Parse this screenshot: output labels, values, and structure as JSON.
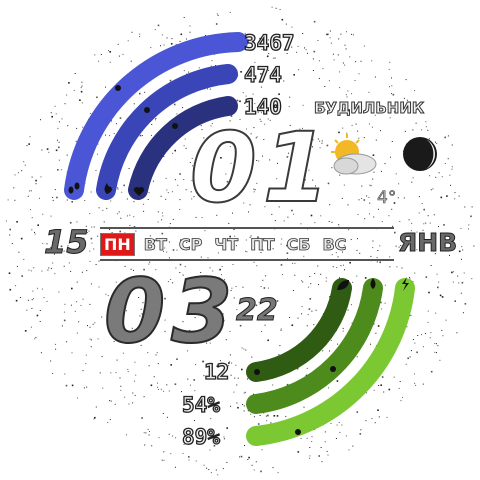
{
  "watchface": {
    "steps": "3467",
    "calories": "474",
    "heart_rate": "140",
    "alarm_label": "БУДИЛЬНИК",
    "hour": "01",
    "minute": "03",
    "seconds": "22",
    "day_of_month": "15",
    "month": "ЯНВ",
    "temperature": "4°",
    "weekdays": [
      "ПН",
      "ВТ",
      "СР",
      "ЧТ",
      "ПТ",
      "СБ",
      "ВС"
    ],
    "active_weekday_index": 0,
    "stat_12": "12",
    "humidity": "54%",
    "battery": "89%",
    "weather_icon": "partly-cloudy-icon",
    "moon_icon": "moon-phase-icon",
    "top_arc_icons": [
      "steps-icon",
      "flame-icon",
      "heart-icon"
    ],
    "bottom_arc_icons": [
      "leaf-icon",
      "drop-icon",
      "bolt-icon"
    ],
    "colors": {
      "arc_blue_outer": "#4b56d6",
      "arc_blue_mid": "#3a45b8",
      "arc_blue_inner": "#2a327f",
      "arc_green_outer": "#7cc832",
      "arc_green_mid": "#4d8c1c",
      "arc_green_inner": "#2f5c12",
      "weekday_active": "#e01818"
    }
  }
}
